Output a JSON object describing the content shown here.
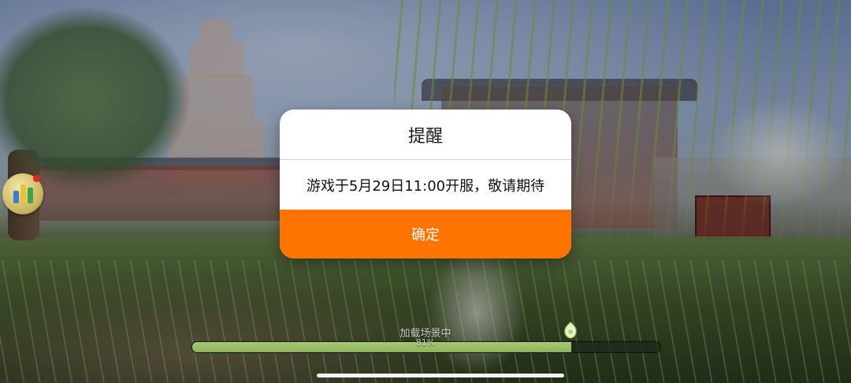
{
  "dialog": {
    "title": "提醒",
    "message": "游戏于5月29日11:00开服，敬请期待",
    "confirm_label": "确定"
  },
  "loading": {
    "label": "加载场景中",
    "percent_text": "81%",
    "progress": 0.81
  },
  "colors": {
    "confirm_button": "#ff7300",
    "progress_fill": "#8db457",
    "badge_dot": "#e3261e"
  },
  "icons": {
    "side_badge": "game-logo-icon",
    "progress_marker": "jade-pendant-icon"
  }
}
